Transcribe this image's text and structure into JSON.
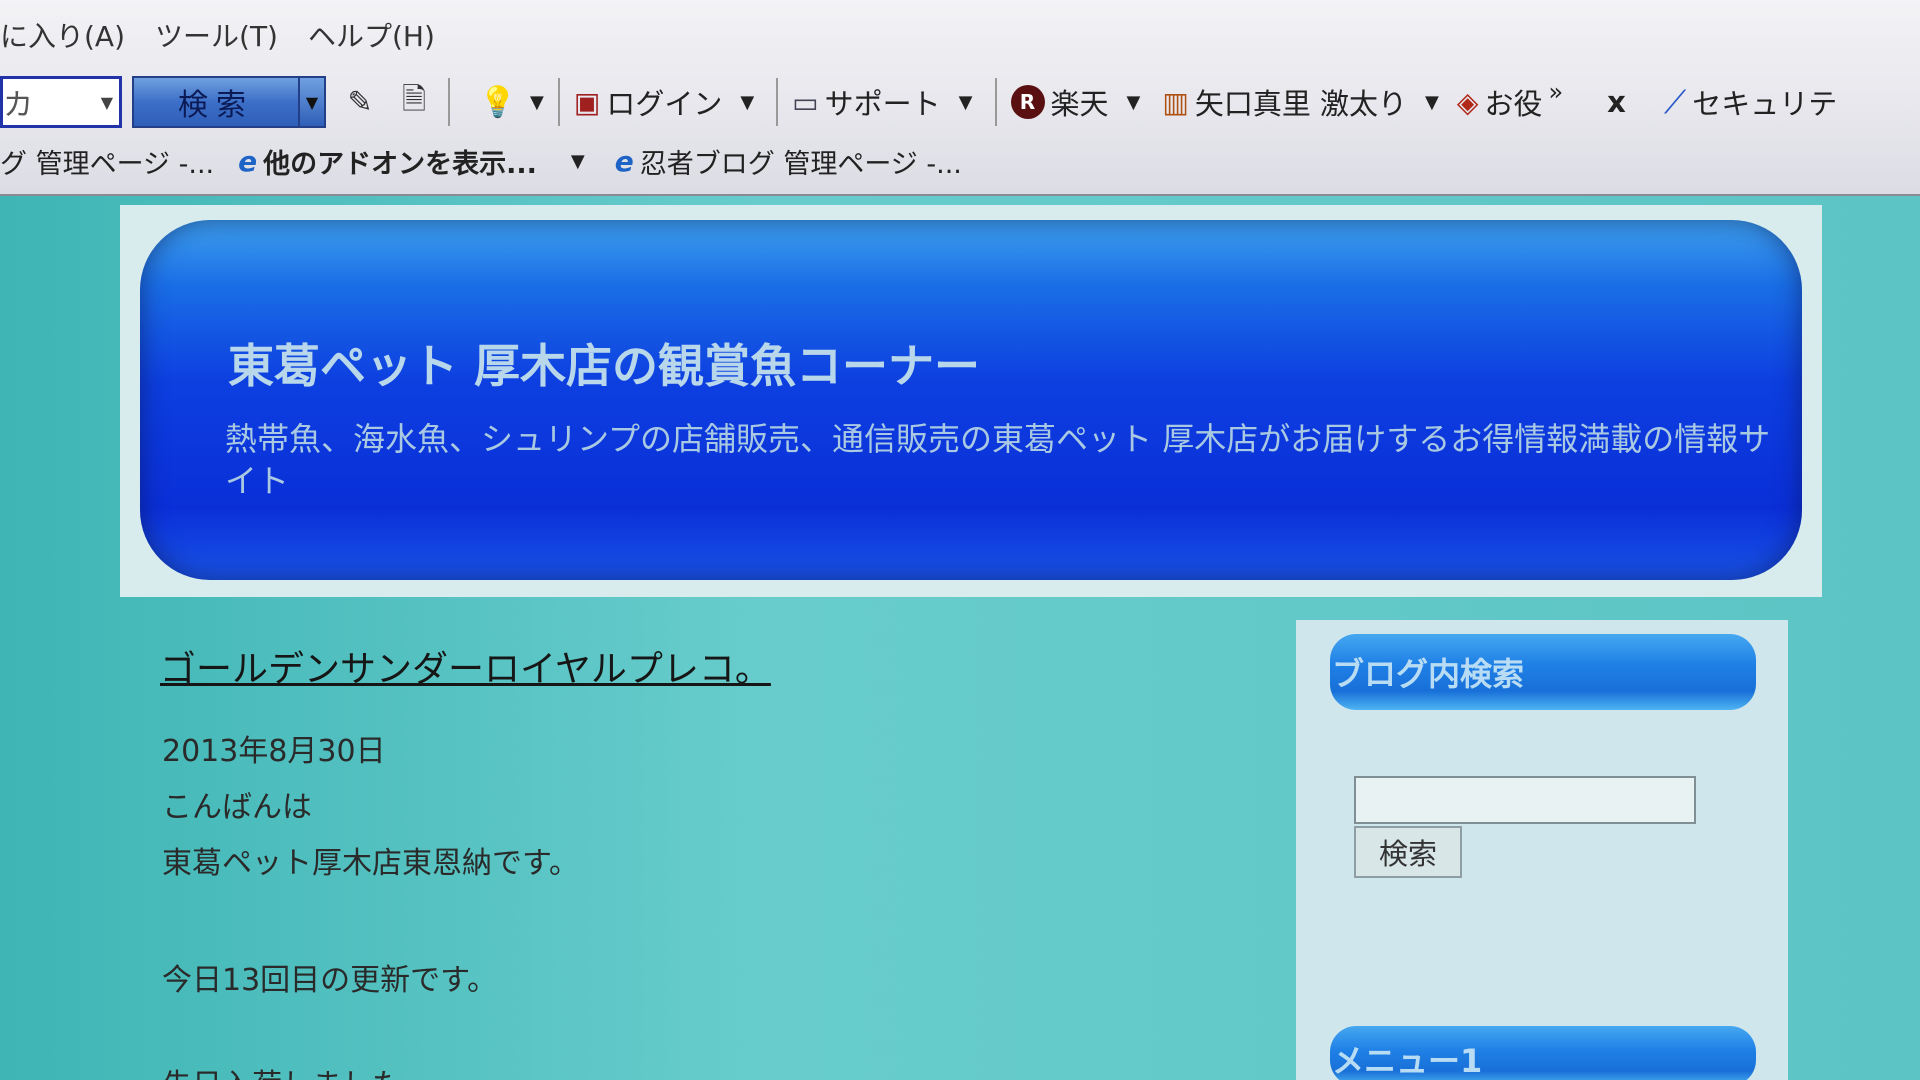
{
  "browser": {
    "menu": [
      "に入り(A)",
      "ツール(T)",
      "ヘルプ(H)"
    ],
    "toolbar": {
      "search_field_text": "カ",
      "search_button": "検索",
      "login": "ログイン",
      "support": "サポート",
      "rakuten_badge": "R",
      "rakuten": "楽天",
      "bookmark": "矢口真里 激太り",
      "otoku": "お役",
      "more": "»",
      "close": "x",
      "security": "セキュリテ"
    },
    "links": {
      "admin_partial": "グ 管理ページ -...",
      "addons": "他のアドオンを表示...",
      "ninja_admin": "忍者ブログ 管理ページ -..."
    }
  },
  "header": {
    "title": "東葛ペット 厚木店の観賞魚コーナー",
    "description": "熱帯魚、海水魚、シュリンプの店舗販売、通信販売の東葛ペット 厚木店がお届けするお得情報満載の情報サイト"
  },
  "post": {
    "title": "ゴールデンサンダーロイヤルプレコ。",
    "date": "2013年8月30日",
    "lines": [
      "こんばんは",
      "東葛ペット厚木店東恩納です。",
      "今日13回目の更新です。",
      "先日入荷しました"
    ]
  },
  "sidebar": {
    "search_heading": "ブログ内検索",
    "search_button": "検索",
    "menu_heading": "メニュー1"
  }
}
